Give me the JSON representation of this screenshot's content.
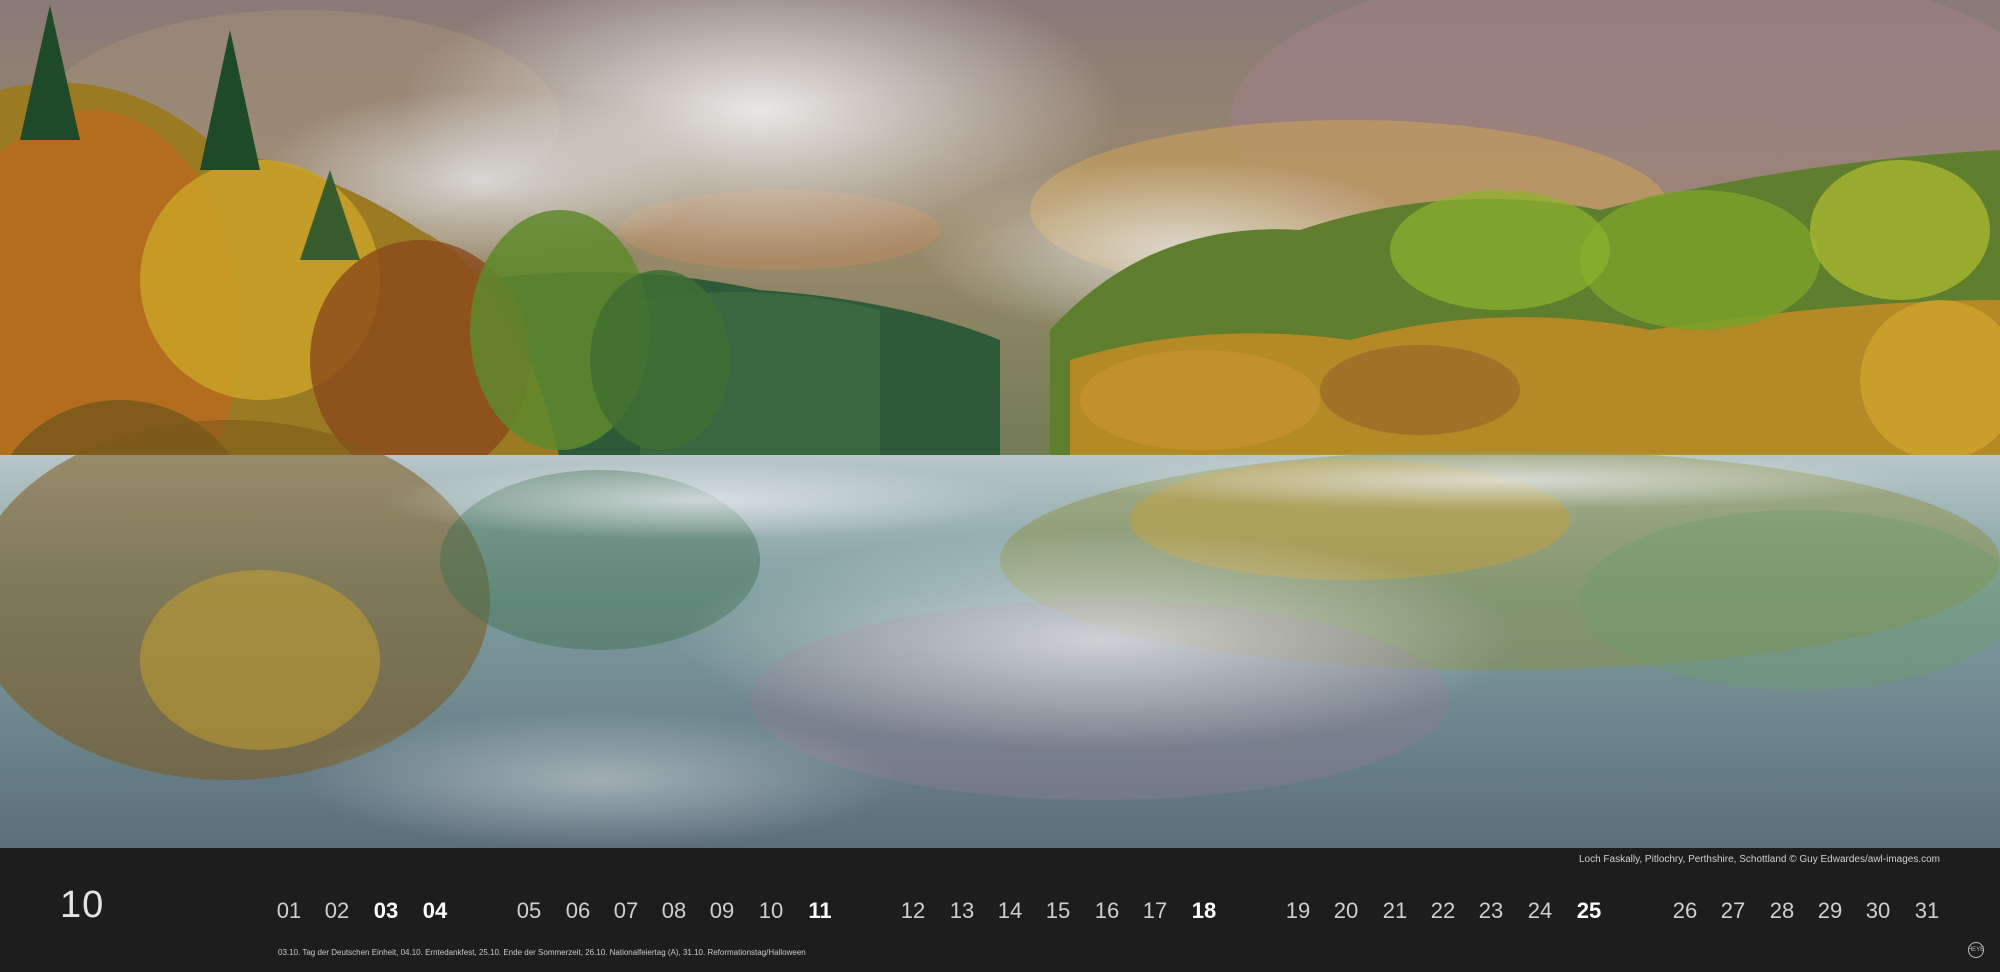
{
  "photo": {
    "credit": "Loch Faskally, Pitlochry, Perthshire, Schottland © Guy Edwardes/awl-images.com"
  },
  "calendar": {
    "month_number": "10",
    "days": [
      {
        "label": "01",
        "bold": false
      },
      {
        "label": "02",
        "bold": false
      },
      {
        "label": "03",
        "bold": true
      },
      {
        "label": "04",
        "bold": true
      },
      {
        "label": "05",
        "bold": false
      },
      {
        "label": "06",
        "bold": false
      },
      {
        "label": "07",
        "bold": false
      },
      {
        "label": "08",
        "bold": false
      },
      {
        "label": "09",
        "bold": false
      },
      {
        "label": "10",
        "bold": false
      },
      {
        "label": "11",
        "bold": true
      },
      {
        "label": "12",
        "bold": false
      },
      {
        "label": "13",
        "bold": false
      },
      {
        "label": "14",
        "bold": false
      },
      {
        "label": "15",
        "bold": false
      },
      {
        "label": "16",
        "bold": false
      },
      {
        "label": "17",
        "bold": false
      },
      {
        "label": "18",
        "bold": true
      },
      {
        "label": "19",
        "bold": false
      },
      {
        "label": "20",
        "bold": false
      },
      {
        "label": "21",
        "bold": false
      },
      {
        "label": "22",
        "bold": false
      },
      {
        "label": "23",
        "bold": false
      },
      {
        "label": "24",
        "bold": false
      },
      {
        "label": "25",
        "bold": true
      },
      {
        "label": "26",
        "bold": false
      },
      {
        "label": "27",
        "bold": false
      },
      {
        "label": "28",
        "bold": false
      },
      {
        "label": "29",
        "bold": false
      },
      {
        "label": "30",
        "bold": false
      },
      {
        "label": "31",
        "bold": false
      }
    ],
    "holidays_note": "03.10. Tag der Deutschen Einheit, 04.10. Erntedankfest, 25.10. Ende der Sommerzeit, 26.10. Nationalfeiertag (A), 31.10. Reformationstag/Halloween"
  },
  "publisher_logo": {
    "text": "HEYE"
  }
}
